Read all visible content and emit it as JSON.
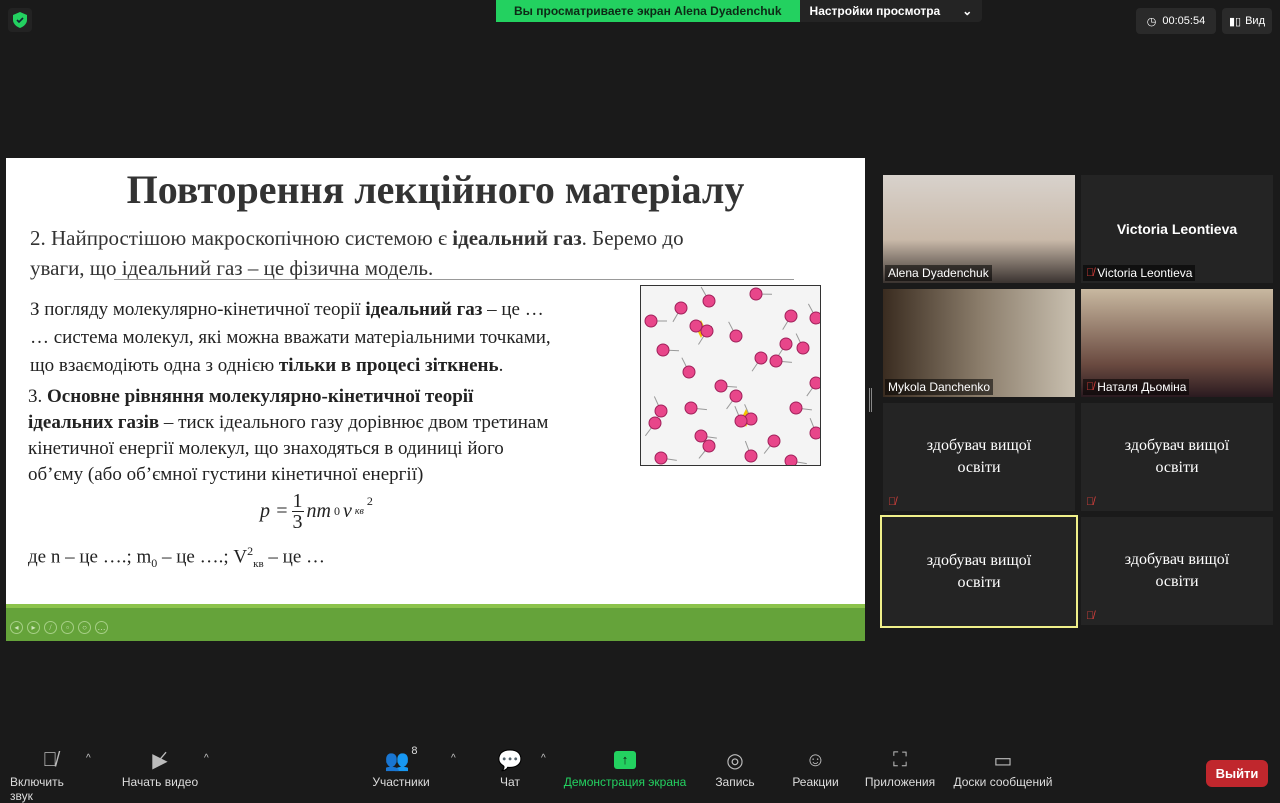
{
  "top": {
    "banner": "Вы просматриваете экран Alena Dyadenchuk",
    "view_settings": "Настройки просмотра",
    "timer": "00:05:54",
    "view": "Вид"
  },
  "slide": {
    "title": "Повторення лекційного матеріалу",
    "p1a": "2. Найпростішою макроскопічною системою є ",
    "p1b": "ідеальний газ",
    "p1c": ". Беремо до",
    "p1d": "уваги, що ідеальний газ – це фізична модель.",
    "p2a": "З погляду молекулярно-кінетичної теорії ",
    "p2b": "ідеальний газ",
    "p2c": " – це …",
    "p3": "… система молекул, які можна вважати матеріальними точками,",
    "p4a": "що взаємодіють одна з однією ",
    "p4b": "тільки в процесі зіткнень",
    "p4c": ".",
    "p5a": "3. ",
    "p5b": "Основне рівняння молекулярно-кінетичної теорії",
    "p6b": "ідеальних газів",
    "p6c": " – тиск ідеального газу дорівнює двом третинам",
    "p7": "кінетичної енергії молекул, що знаходяться в одиниці його",
    "p8": "об’єму (або об’ємної густини кінетичної енергії)",
    "formula": {
      "lhs": "p =",
      "num": "1",
      "den": "3",
      "nm": "nm",
      "sub0": "0",
      "v": "v",
      "kv": "кв",
      "sq": "2"
    },
    "p9a": "де n – це ….; m",
    "p9sub": "0",
    "p9b": " – це ….;  V",
    "p9sup": "2",
    "p9sub2": "кв",
    "p9c": " – це …"
  },
  "participants": [
    {
      "name": "Alena Dyadenchuk",
      "muted": false,
      "video": true
    },
    {
      "name": "Victoria Leontieva",
      "muted": true,
      "video": false,
      "display": "Victoria Leontieva"
    },
    {
      "name": "Mykola Danchenko",
      "muted": false,
      "video": true
    },
    {
      "name": "Наталя Дьоміна",
      "muted": true,
      "video": true
    },
    {
      "display": "здобувач вищої освіти",
      "muted": true
    },
    {
      "display": "здобувач вищої освіти",
      "muted": true
    },
    {
      "display": "здобувач вищої освіти",
      "muted": false,
      "active": true
    },
    {
      "display": "здобувач вищої освіти",
      "muted": true
    }
  ],
  "toolbar": {
    "audio": "Включить звук",
    "video": "Начать видео",
    "participants": "Участники",
    "participants_count": "8",
    "chat": "Чат",
    "share": "Демонстрация экрана",
    "record": "Запись",
    "reactions": "Реакции",
    "apps": "Приложения",
    "whiteboards": "Доски сообщений",
    "leave": "Выйти"
  },
  "colors": {
    "accent": "#23d160",
    "leave": "#c0272d",
    "slide_green": "#65a33a",
    "active_border": "#f0f08a"
  }
}
